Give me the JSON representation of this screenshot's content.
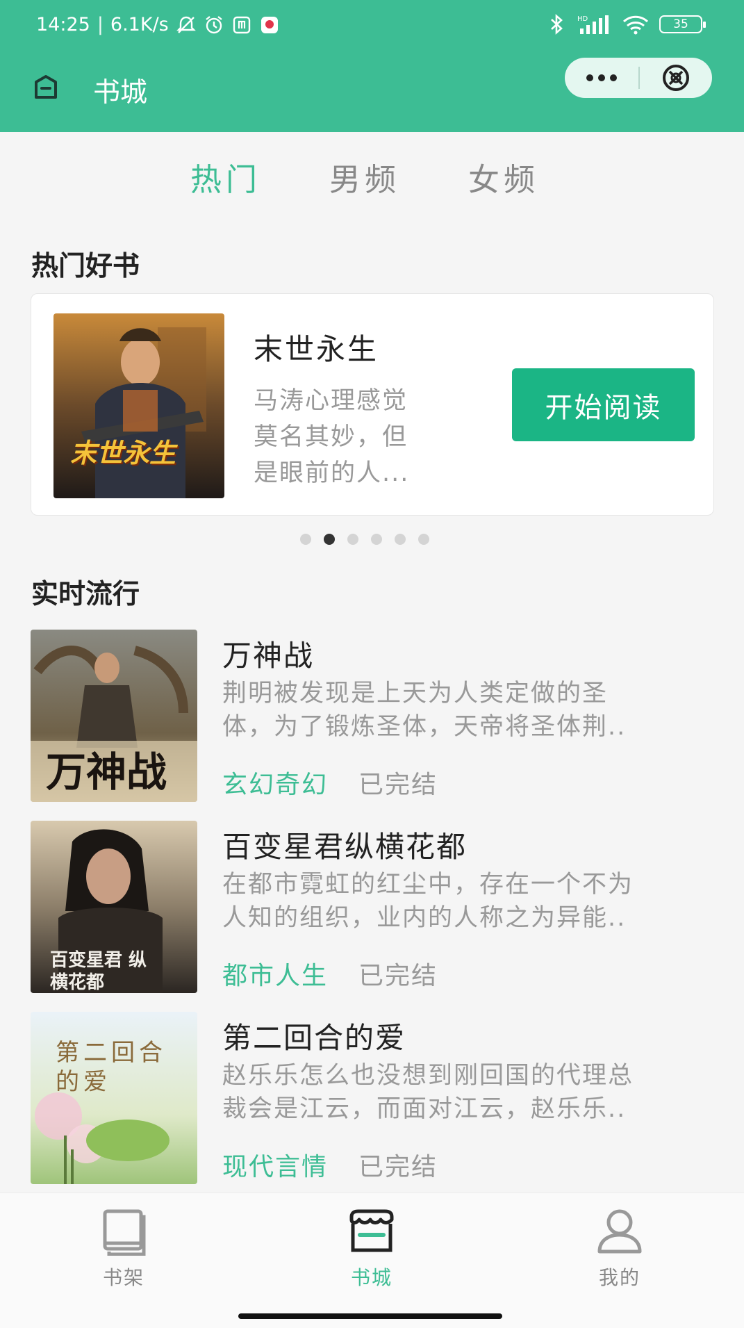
{
  "status_bar": {
    "time": "14:25",
    "network_speed": "6.1K/s",
    "battery": "35",
    "icons": [
      "mute-bell-icon",
      "alarm-icon",
      "nfc-icon",
      "app-notification-icon",
      "bluetooth-icon",
      "hd-signal-icon",
      "wifi-icon",
      "battery-icon"
    ]
  },
  "header": {
    "title": "书城",
    "accent_color": "#3dbd94"
  },
  "tabs": [
    {
      "label": "热门",
      "active": true
    },
    {
      "label": "男频",
      "active": false
    },
    {
      "label": "女频",
      "active": false
    }
  ],
  "featured": {
    "section_title": "热门好书",
    "book": {
      "title": "末世永生",
      "desc_lines": [
        "马涛心理感觉",
        "莫名其妙，但",
        "是眼前的人..."
      ],
      "cover_text": "末世永生"
    },
    "button_label": "开始阅读",
    "carousel_total": 6,
    "carousel_active": 2
  },
  "trending": {
    "section_title": "实时流行",
    "books": [
      {
        "title": "万神战",
        "desc_lines": [
          "荆明被发现是上天为人类定做的圣",
          "体，为了锻炼圣体，天帝将圣体荆.."
        ],
        "genre": "玄幻奇幻",
        "status": "已完结",
        "cover_text": "万神战"
      },
      {
        "title": "百变星君纵横花都",
        "desc_lines": [
          "在都市霓虹的红尘中，存在一个不为",
          "人知的组织，业内的人称之为异能.."
        ],
        "genre": "都市人生",
        "status": "已完结",
        "cover_text": "百变星君 纵横花都"
      },
      {
        "title": "第二回合的爱",
        "desc_lines": [
          "赵乐乐怎么也没想到刚回国的代理总",
          "裁会是江云，而面对江云，赵乐乐.."
        ],
        "genre": "现代言情",
        "status": "已完结",
        "cover_text": "第二回合的爱"
      }
    ]
  },
  "tabbar": {
    "items": [
      {
        "label": "书架",
        "icon": "bookshelf-icon",
        "active": false
      },
      {
        "label": "书城",
        "icon": "bookstore-icon",
        "active": true
      },
      {
        "label": "我的",
        "icon": "profile-icon",
        "active": false
      }
    ]
  }
}
